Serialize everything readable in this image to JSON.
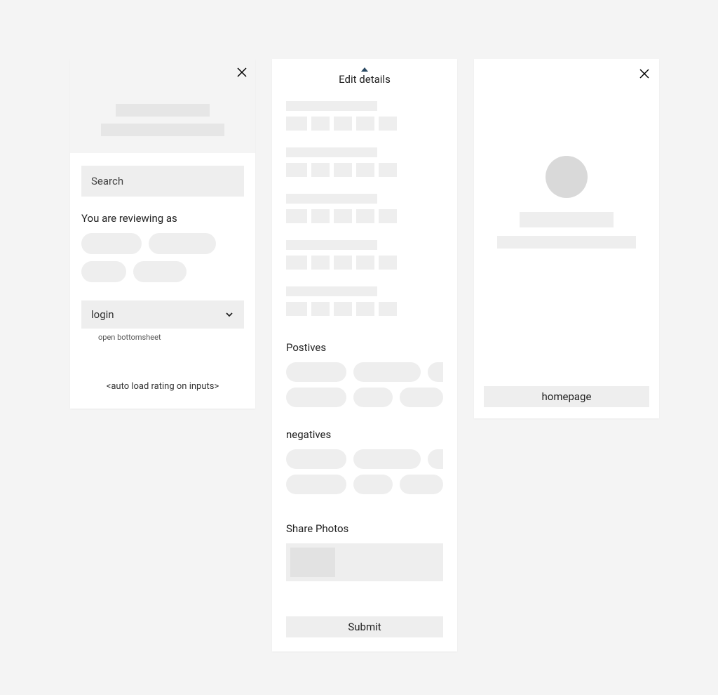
{
  "panel1": {
    "search_placeholder": "Search",
    "reviewing_label": "You are reviewing as",
    "login_label": "login",
    "login_hint": "open bottomsheet",
    "autoload_note": "<auto load rating on inputs>"
  },
  "panel2": {
    "title": "Edit details",
    "positives_label": "Postives",
    "negatives_label": "negatives",
    "share_photos_label": "Share Photos",
    "submit_label": "Submit"
  },
  "panel3": {
    "homepage_label": "homepage"
  }
}
